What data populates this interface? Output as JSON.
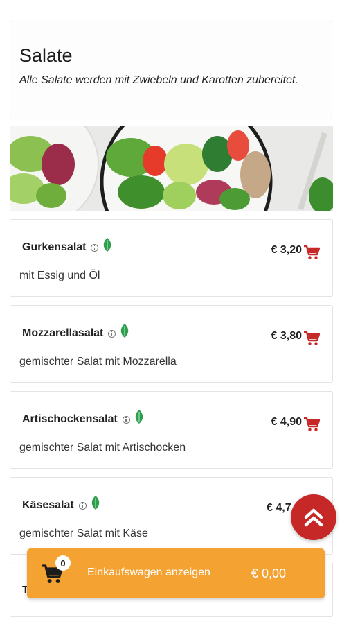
{
  "section": {
    "title": "Salate",
    "description": "Alle Salate werden mit Zwiebeln und Karotten zubereitet."
  },
  "items": [
    {
      "name": "Gurkensalat",
      "description": "mit Essig und Öl",
      "price": "€ 3,20"
    },
    {
      "name": "Mozzarellasalat",
      "description": "gemischter Salat mit Mozzarella",
      "price": "€ 3,80"
    },
    {
      "name": "Artischockensalat",
      "description": "gemischter Salat mit Artischocken",
      "price": "€ 4,90"
    },
    {
      "name": "Käsesalat",
      "description": "gemischter Salat mit Käse",
      "price": "€ 4,7"
    }
  ],
  "partial_item": {
    "name_start": "T"
  },
  "cart": {
    "count": "0",
    "label": "Einkaufswagen anzeigen",
    "total": "€ 0,00"
  },
  "icons": {
    "info": "info-icon",
    "vegetarian": "leaf-icon",
    "add_to_cart": "cart-icon",
    "scroll_top": "double-chevron-up-icon"
  },
  "colors": {
    "accent_red": "#c62828",
    "cart_bar_orange": "#f4a232",
    "leaf_green": "#2e9e4f"
  }
}
